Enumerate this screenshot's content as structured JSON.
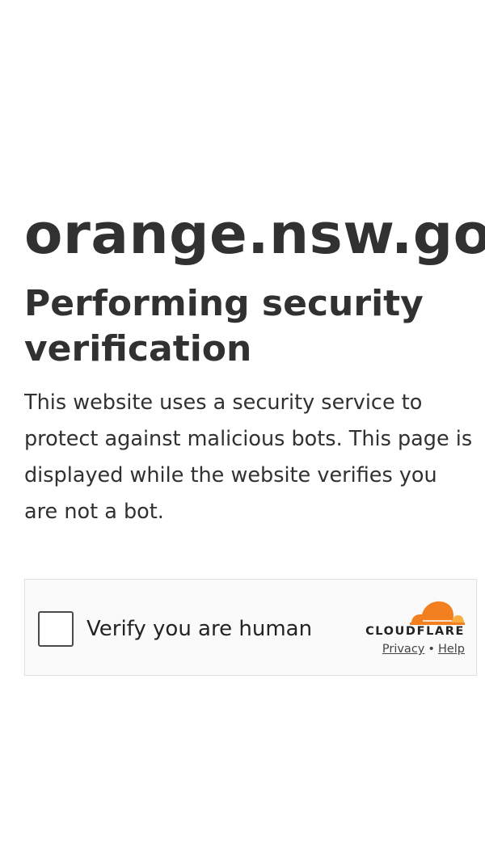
{
  "site": {
    "name": "orange.nsw.gov.au"
  },
  "main": {
    "heading": "Performing security verification",
    "description": "This website uses a security service to protect against malicious bots. This page is displayed while the website verifies you are not a bot."
  },
  "widget": {
    "checkbox_label": "Verify you are human",
    "checked": false,
    "brand": "CLOUDFLARE",
    "privacy_link": "Privacy",
    "separator": "•",
    "help_link": "Help",
    "brand_colors": {
      "orange": "#f38020",
      "light_orange": "#faae40"
    }
  }
}
